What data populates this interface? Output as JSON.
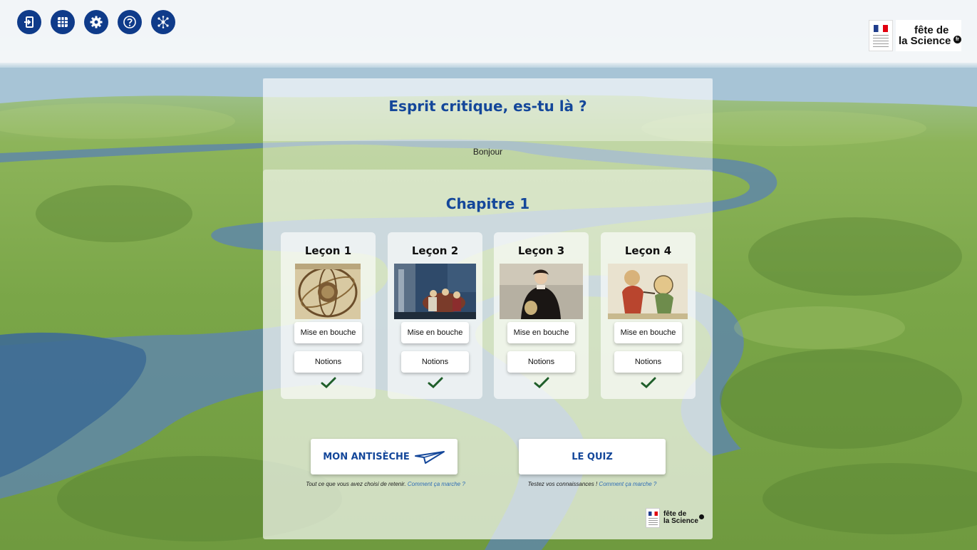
{
  "toolbar": {
    "buttons": [
      {
        "name": "exit-icon"
      },
      {
        "name": "grid-icon"
      },
      {
        "name": "settings-icon"
      },
      {
        "name": "help-icon"
      },
      {
        "name": "network-icon"
      }
    ]
  },
  "brand": {
    "logo_line1": "fête de",
    "logo_line2": "la Science",
    "logo_badge": "fr"
  },
  "main": {
    "title": "Esprit critique, es-tu là ?",
    "greeting": "Bonjour",
    "chapter_title": "Chapitre 1",
    "lessons": [
      {
        "title": "Leçon 1",
        "button1": "Mise en bouche",
        "button2": "Notions",
        "completed": true
      },
      {
        "title": "Leçon 2",
        "button1": "Mise en bouche",
        "button2": "Notions",
        "completed": true
      },
      {
        "title": "Leçon 3",
        "button1": "Mise en bouche",
        "button2": "Notions",
        "completed": true
      },
      {
        "title": "Leçon 4",
        "button1": "Mise en bouche",
        "button2": "Notions",
        "completed": true
      }
    ],
    "antiseche": {
      "label": "MON ANTISÈCHE",
      "caption": "Tout ce que vous avez choisi de retenir.",
      "link": "Comment ça marche ?"
    },
    "quiz": {
      "label": "LE QUIZ",
      "caption": "Testez vos connaissances !",
      "link": "Comment ça marche ?"
    }
  },
  "colors": {
    "accent": "#14479a",
    "toolbar_button": "#0f3b8a",
    "check": "#1f5e2a"
  }
}
